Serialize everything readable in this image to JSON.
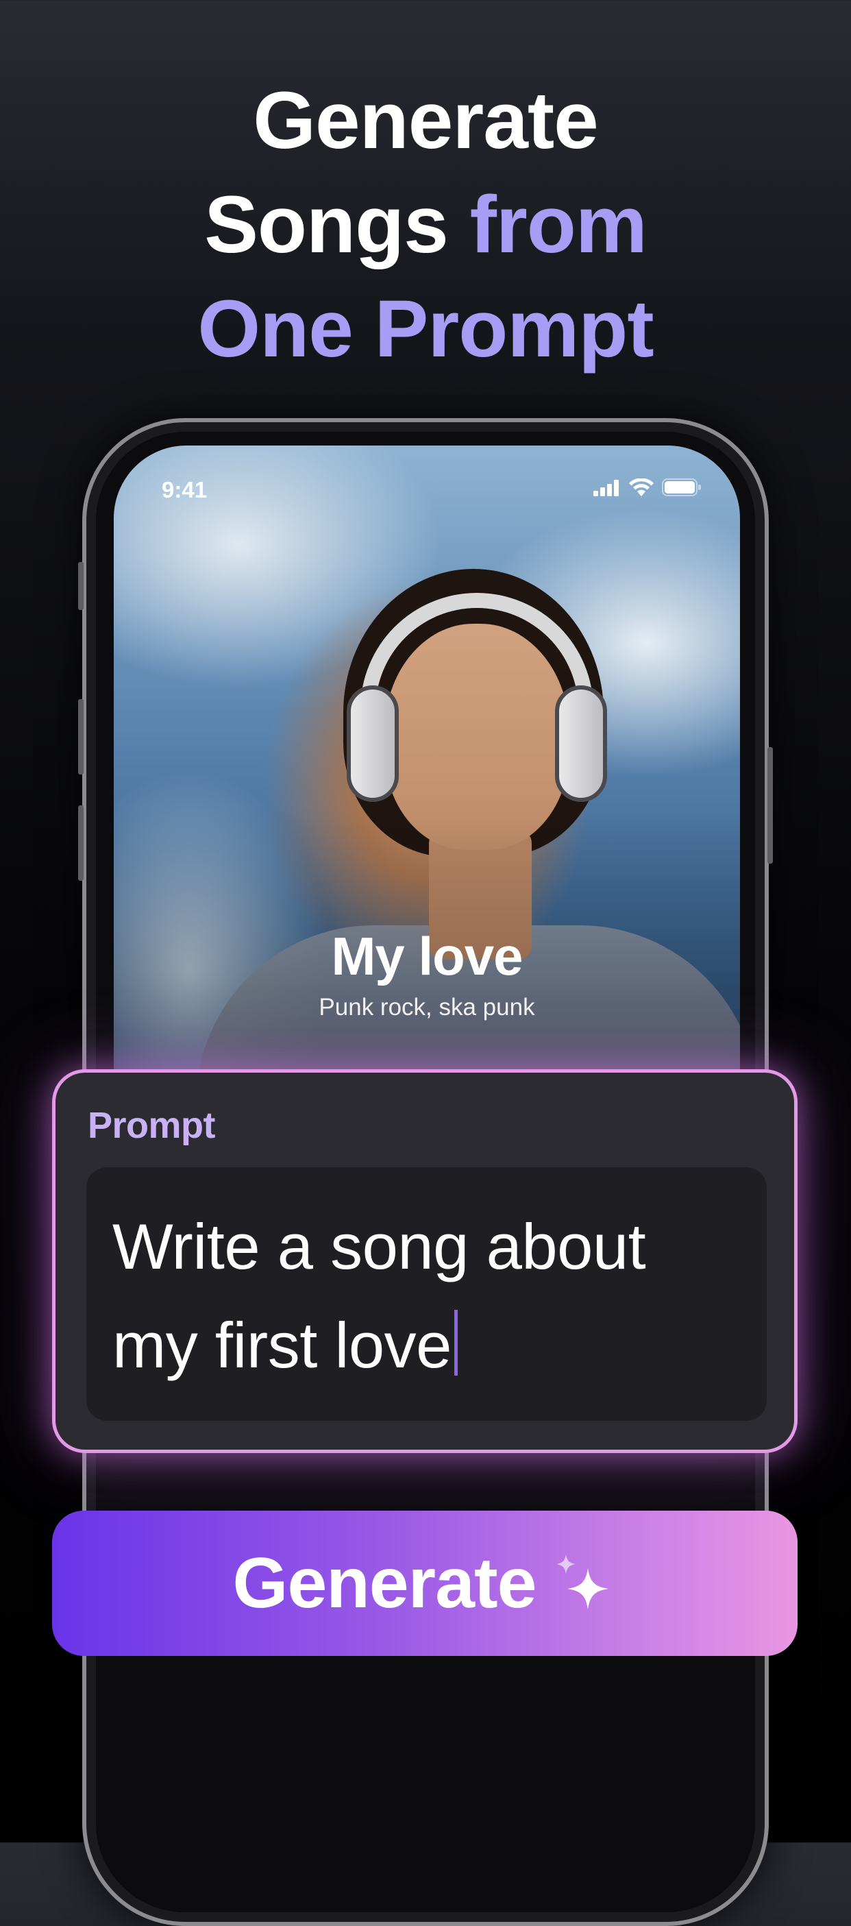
{
  "headline": {
    "line1": "Generate",
    "line2_white": "Songs ",
    "line2_accent": "from",
    "line3": "One Prompt"
  },
  "status_bar": {
    "time": "9:41",
    "icons": [
      "cellular-signal-icon",
      "wifi-icon",
      "battery-icon"
    ]
  },
  "song": {
    "title": "My love",
    "genre": "Punk rock, ska punk"
  },
  "prompt": {
    "label": "Prompt",
    "value": "Write a song about my first love"
  },
  "generate_button": {
    "label": "Generate",
    "icon": "sparkles-icon"
  },
  "colors": {
    "accent": "#a99cf5",
    "prompt_border": "#e39ae6",
    "button_start": "#6a34e8",
    "button_end": "#e996e2"
  }
}
